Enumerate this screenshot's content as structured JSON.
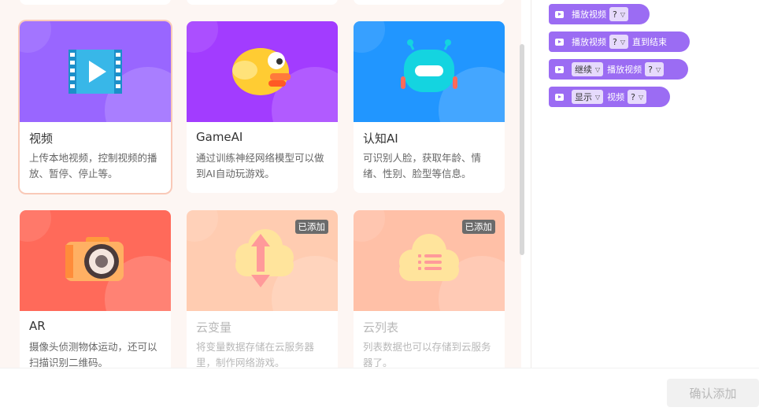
{
  "colors": {
    "video": "#9966ff",
    "gameai": "#a23cff",
    "cognitive": "#2196ff",
    "ar": "#ff6a5a",
    "cloud_var": "#ffccb1",
    "cloud_list": "#ffc0a7",
    "block": "#9b6cf3"
  },
  "cards": [
    {
      "title": "视频",
      "desc": "上传本地视频，控制视频的播放、暂停、停止等。",
      "icon": "film-play-icon",
      "badge": ""
    },
    {
      "title": "GameAI",
      "desc": "通过训练神经网络模型可以做到AI自动玩游戏。",
      "icon": "flappy-bird-icon",
      "badge": ""
    },
    {
      "title": "认知AI",
      "desc": "可识别人脸，获取年龄、情绪、性别、脸型等信息。",
      "icon": "robot-icon",
      "badge": ""
    },
    {
      "title": "AR",
      "desc": "摄像头侦测物体运动，还可以扫描识别二维码。",
      "icon": "camera-icon",
      "badge": ""
    },
    {
      "title": "云变量",
      "desc": "将变量数据存储在云服务器里，制作网络游戏。",
      "icon": "cloud-upload-icon",
      "badge": "已添加"
    },
    {
      "title": "云列表",
      "desc": "列表数据也可以存储到云服务器了。",
      "icon": "cloud-list-icon",
      "badge": "已添加"
    }
  ],
  "blocks": [
    {
      "parts": [
        {
          "t": "text",
          "v": "播放视频"
        },
        {
          "t": "dd",
          "v": "?"
        }
      ]
    },
    {
      "parts": [
        {
          "t": "text",
          "v": "播放视频"
        },
        {
          "t": "dd",
          "v": "?"
        },
        {
          "t": "text",
          "v": "直到结束"
        }
      ]
    },
    {
      "parts": [
        {
          "t": "dd",
          "v": "继续"
        },
        {
          "t": "text",
          "v": "播放视频"
        },
        {
          "t": "dd",
          "v": "?"
        }
      ]
    },
    {
      "parts": [
        {
          "t": "dd",
          "v": "显示"
        },
        {
          "t": "text",
          "v": "视频"
        },
        {
          "t": "dd",
          "v": "?"
        }
      ]
    }
  ],
  "footer": {
    "confirm_label": "确认添加"
  }
}
